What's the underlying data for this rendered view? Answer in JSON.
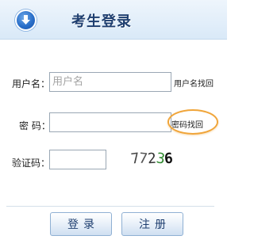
{
  "header": {
    "title": "考生登录",
    "icon": "download-arrow-icon"
  },
  "form": {
    "username": {
      "label": "用户名：",
      "placeholder": "用户名",
      "value": "",
      "link": "用户名找回"
    },
    "password": {
      "label": "密  码：",
      "value": "",
      "link": "密码找回"
    },
    "captcha": {
      "label": "验证码：",
      "value": "",
      "code_chars": [
        "7",
        "7",
        "2",
        "3",
        "6"
      ]
    }
  },
  "buttons": {
    "login": "登录",
    "register": "注册"
  },
  "colors": {
    "highlight_ring": "#f0a53a",
    "title": "#1f3f70",
    "captcha_green": "#2e8a2e"
  }
}
